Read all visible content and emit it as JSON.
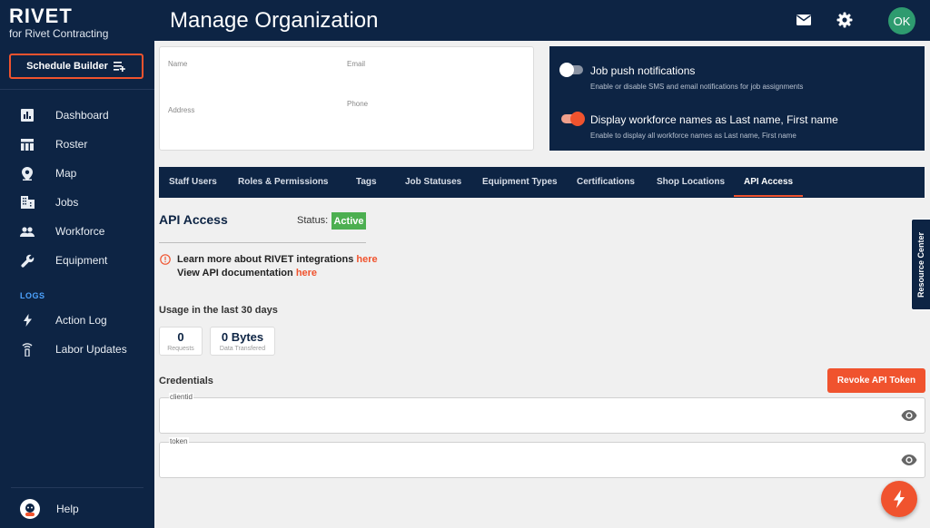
{
  "brand": {
    "name": "RIVET",
    "subtitle": "for Rivet Contracting"
  },
  "sidebar": {
    "schedule_builder": "Schedule Builder",
    "items": [
      {
        "label": "Dashboard",
        "icon": "dashboard-icon"
      },
      {
        "label": "Roster",
        "icon": "roster-icon"
      },
      {
        "label": "Map",
        "icon": "map-pin-icon"
      },
      {
        "label": "Jobs",
        "icon": "jobs-icon"
      },
      {
        "label": "Workforce",
        "icon": "people-icon"
      },
      {
        "label": "Equipment",
        "icon": "wrench-icon"
      }
    ],
    "logs_section": "LOGS",
    "log_items": [
      {
        "label": "Action Log",
        "icon": "lightning-icon"
      },
      {
        "label": "Labor Updates",
        "icon": "signal-icon"
      }
    ],
    "help": "Help"
  },
  "header": {
    "title": "Manage Organization",
    "avatar_initials": "OK"
  },
  "profile": {
    "name_label": "Name",
    "email_label": "Email",
    "address_label": "Address",
    "phone_label": "Phone"
  },
  "settings": {
    "items": [
      {
        "title": "Job push notifications",
        "desc": "Enable or disable SMS and email notifications for job assignments",
        "enabled": false
      },
      {
        "title": "Display workforce names as Last name, First name",
        "desc": "Enable to display all workforce names as Last name, First name",
        "enabled": true
      }
    ]
  },
  "tabs": [
    {
      "label": "Staff Users"
    },
    {
      "label": "Roles & Permissions"
    },
    {
      "label": "Tags"
    },
    {
      "label": "Job Statuses"
    },
    {
      "label": "Equipment Types"
    },
    {
      "label": "Certifications"
    },
    {
      "label": "Shop Locations"
    },
    {
      "label": "API Access",
      "active": true
    }
  ],
  "api": {
    "title": "API Access",
    "status_label": "Status:",
    "status_value": "Active",
    "learn_text": "Learn more about RIVET integrations",
    "learn_link": "here",
    "docs_text": "View API documentation",
    "docs_link": "here",
    "usage_title": "Usage in the last 30 days",
    "requests_value": "0",
    "requests_label": "Requests",
    "data_value": "0 Bytes",
    "data_label": "Data Transfered",
    "credentials_title": "Credentials",
    "revoke_button": "Revoke API Token",
    "clientid_label": "clientid",
    "token_label": "token"
  },
  "resource_center": "Resource Center",
  "colors": {
    "navy": "#0d2444",
    "accent": "#f0532e",
    "status_green": "#4caf50",
    "avatar_green": "#2e9b6f"
  }
}
